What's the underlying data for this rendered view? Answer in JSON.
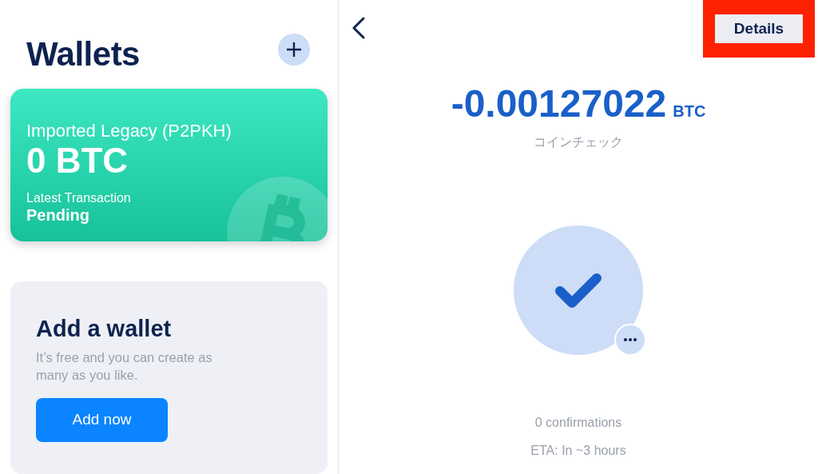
{
  "wallets_panel": {
    "title": "Wallets",
    "wallet_card": {
      "name": "Imported Legacy (P2PKH)",
      "balance": "0 BTC",
      "latest_label": "Latest Transaction",
      "latest_value": "Pending"
    },
    "add_card": {
      "title": "Add a wallet",
      "description": "It’s free and you can create as many as you like.",
      "button": "Add now"
    }
  },
  "transaction": {
    "details_button": {
      "label": "Details",
      "highlighted": true
    },
    "amount": "-0.00127022",
    "unit": "BTC",
    "memo": "コインチェック",
    "confirmations": "0 confirmations",
    "eta": "ETA: In ~3 hours"
  }
}
